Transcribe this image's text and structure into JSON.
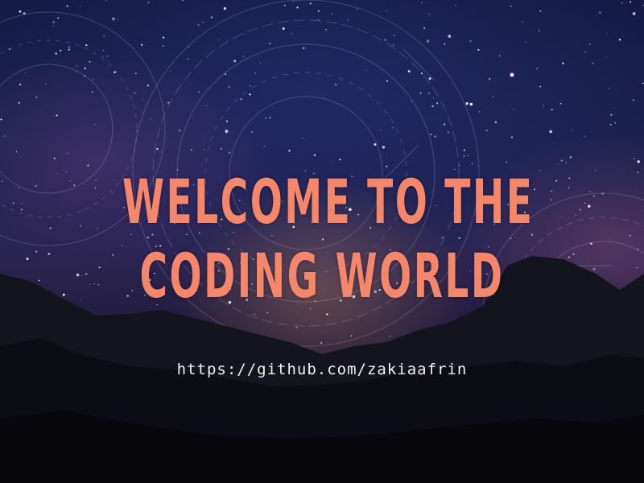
{
  "headline": {
    "line1": "WELCOME TO THE",
    "line2": "CODING WORLD"
  },
  "link": {
    "text": "https://github.com/zakiaafrin"
  },
  "colors": {
    "headline": "#f4866a",
    "link": "#f2f0ee",
    "sky_top": "#141a44",
    "ground": "#0c0c18"
  }
}
